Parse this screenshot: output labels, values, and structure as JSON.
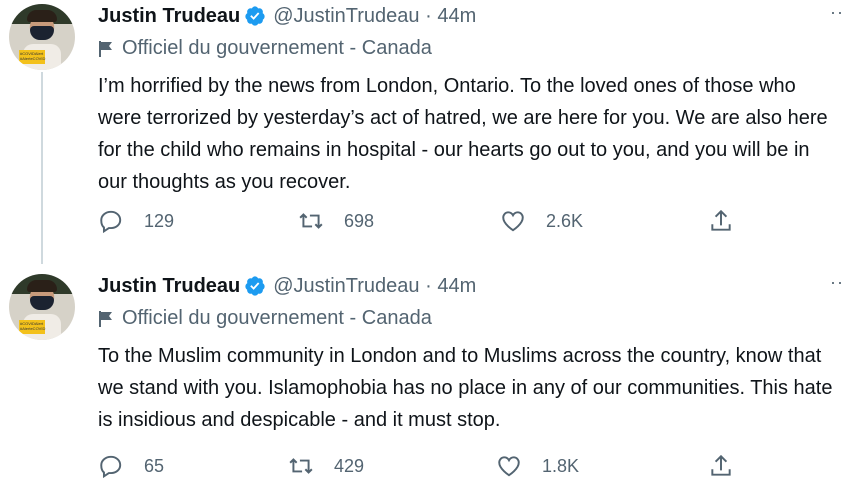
{
  "tweets": [
    {
      "author": "Justin Trudeau",
      "handle": "@JustinTrudeau · 44m",
      "label": "Officiel du gouvernement - Canada",
      "text": "I’m horrified by the news from London, Ontario. To the loved ones of those who were terrorized by yesterday’s act of hatred, we are here for you. We are also here for the child who remains in hospital - our hearts go out to you, and you will be in our thoughts as you recover.",
      "replies": "129",
      "retweets": "698",
      "likes": "2.6K",
      "avatar_badge": "#COVIDAlert #AlerteCOVID"
    },
    {
      "author": "Justin Trudeau",
      "handle": "@JustinTrudeau · 44m",
      "label": "Officiel du gouvernement - Canada",
      "text": "To the Muslim community in London and to Muslims across the country, know that we stand with you. Islamophobia has no place in any of our communities. This hate is insidious and despicable - and it must stop.",
      "replies": "65",
      "retweets": "429",
      "likes": "1.8K",
      "avatar_badge": "#COVIDAlert #AlerteCOVID"
    }
  ],
  "icons": {
    "verified": "verified-badge-icon",
    "flag": "flag-icon",
    "more": "more-icon",
    "reply": "reply-icon",
    "retweet": "retweet-icon",
    "like": "heart-icon",
    "share": "share-icon"
  },
  "colors": {
    "verified": "#1d9bf0",
    "secondary_text": "#536471",
    "thread_line": "#cfd9de"
  }
}
